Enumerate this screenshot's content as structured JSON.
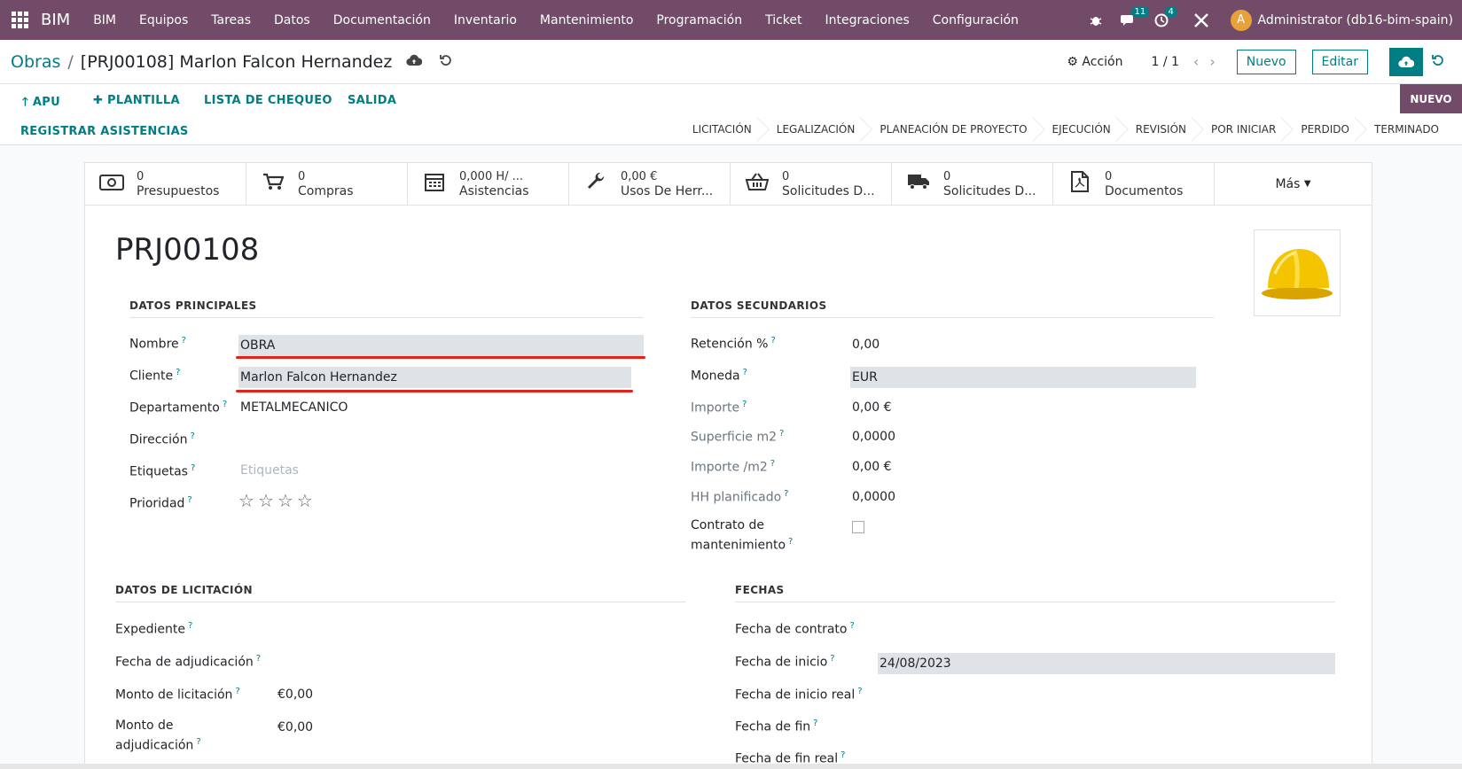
{
  "navbar": {
    "brand": "BIM",
    "menu": [
      "BIM",
      "Equipos",
      "Tareas",
      "Datos",
      "Documentación",
      "Inventario",
      "Mantenimiento",
      "Programación",
      "Ticket",
      "Integraciones",
      "Configuración"
    ],
    "messages_count": "11",
    "activities_count": "4",
    "avatar_letter": "A",
    "user": "Administrator (db16-bim-spain)"
  },
  "control_panel": {
    "breadcrumb_parent": "Obras",
    "breadcrumb_current": "[PRJ00108] Marlon Falcon Hernandez",
    "action_label": "Acción",
    "pager": "1 / 1",
    "new_label": "Nuevo",
    "edit_label": "Editar"
  },
  "header_buttons": {
    "apu": "APU",
    "plantilla": "PLANTILLA",
    "lista": "LISTA DE CHEQUEO",
    "salida": "SALIDA",
    "registrar": "REGISTRAR ASISTENCIAS"
  },
  "stages": [
    "LICITACIÓN",
    "LEGALIZACIÓN",
    "PLANEACIÓN DE PROYECTO",
    "EJECUCIÓN",
    "REVISIÓN",
    "POR INICIAR",
    "PERDIDO",
    "TERMINADO"
  ],
  "current_stage": "NUEVO",
  "smart_buttons": [
    {
      "value": "0",
      "label": "Presupuestos",
      "icon": "money-icon"
    },
    {
      "value": "0",
      "label": "Compras",
      "icon": "cart-icon"
    },
    {
      "value": "0,000 H/ ...",
      "label": "Asistencias",
      "icon": "calendar-icon"
    },
    {
      "value": "0,00 €",
      "label": "Usos De Herr...",
      "icon": "wrench-icon"
    },
    {
      "value": "0",
      "label": "Solicitudes D...",
      "icon": "basket-icon"
    },
    {
      "value": "0",
      "label": "Solicitudes D...",
      "icon": "truck-icon"
    },
    {
      "value": "0",
      "label": "Documentos",
      "icon": "pdf-icon"
    }
  ],
  "more_label": "Más",
  "record": {
    "title": "PRJ00108",
    "datos_principales": {
      "title": "DATOS PRINCIPALES",
      "nombre_label": "Nombre",
      "nombre": "OBRA",
      "cliente_label": "Cliente",
      "cliente": "Marlon Falcon Hernandez",
      "departamento_label": "Departamento",
      "departamento": "METALMECANICO",
      "direccion_label": "Dirección",
      "etiquetas_label": "Etiquetas",
      "etiquetas_placeholder": "Etiquetas",
      "prioridad_label": "Prioridad"
    },
    "datos_secundarios": {
      "title": "DATOS SECUNDARIOS",
      "retencion_label": "Retención %",
      "retencion": "0,00",
      "moneda_label": "Moneda",
      "moneda": "EUR",
      "importe_label": "Importe",
      "importe": "0,00 €",
      "superficie_label": "Superficie m2",
      "superficie": "0,0000",
      "importe_m2_label": "Importe /m2",
      "importe_m2": "0,00 €",
      "hh_label": "HH planificado",
      "hh": "0,0000",
      "contrato_label_1": "Contrato de",
      "contrato_label_2": "mantenimiento"
    },
    "datos_licitacion": {
      "title": "DATOS DE LICITACIÓN",
      "expediente_label": "Expediente",
      "fecha_adj_label": "Fecha de adjudicación",
      "monto_lic_label": "Monto de licitación",
      "monto_lic": "€0,00",
      "monto_adj_label_1": "Monto de",
      "monto_adj_label_2": "adjudicación",
      "monto_adj": "€0,00"
    },
    "fechas": {
      "title": "FECHAS",
      "contrato_label": "Fecha de contrato",
      "inicio_label": "Fecha de inicio",
      "inicio": "24/08/2023",
      "inicio_real_label": "Fecha de inicio real",
      "fin_label": "Fecha de fin",
      "fin_real_label": "Fecha de fin real"
    }
  },
  "colors": {
    "brand": "#714B67",
    "accent": "#017e84",
    "annotation": "#e2231a"
  }
}
